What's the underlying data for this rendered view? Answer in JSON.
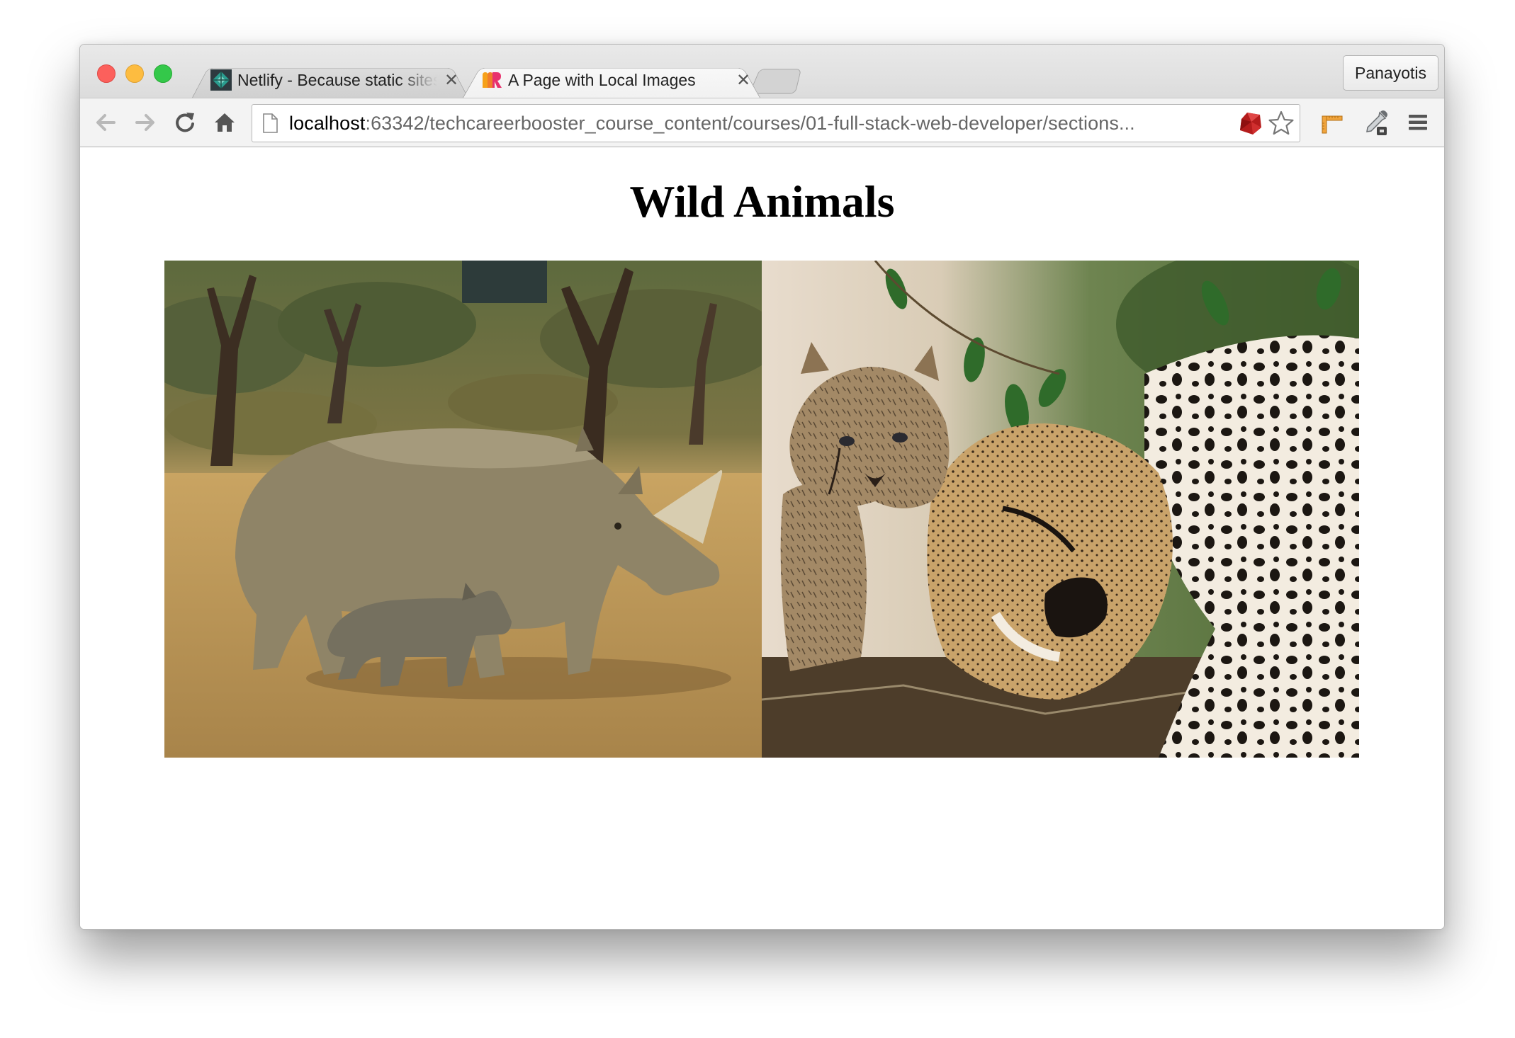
{
  "browser": {
    "tabs": [
      {
        "title": "Netlify - Because static sites",
        "favicon": "netlify-icon",
        "active": false
      },
      {
        "title": "A Page with Local Images",
        "favicon": "jetbrains-icon",
        "active": true
      }
    ],
    "close_glyph": "✕",
    "profile_name": "Panayotis",
    "url_host": "localhost",
    "url_rest": ":63342/techcareerbooster_course_content/courses/01-full-stack-web-developer/sections...",
    "toolbar_icons": [
      "back-arrow-icon",
      "forward-arrow-icon",
      "reload-icon",
      "home-icon",
      "page-icon",
      "ruby-extension-icon",
      "bookmark-star-icon",
      "ruler-extension-icon",
      "eyedropper-extension-icon",
      "menu-icon"
    ]
  },
  "page": {
    "heading": "Wild Animals",
    "images": [
      {
        "subject": "rhino-mother-and-calf"
      },
      {
        "subject": "cheetah-mother-and-cub"
      }
    ]
  },
  "colors": {
    "close_red": "#fc605c",
    "minimize_yellow": "#fdbc40",
    "zoom_green": "#34c84a",
    "netlify_teal": "#2a9d8f"
  }
}
